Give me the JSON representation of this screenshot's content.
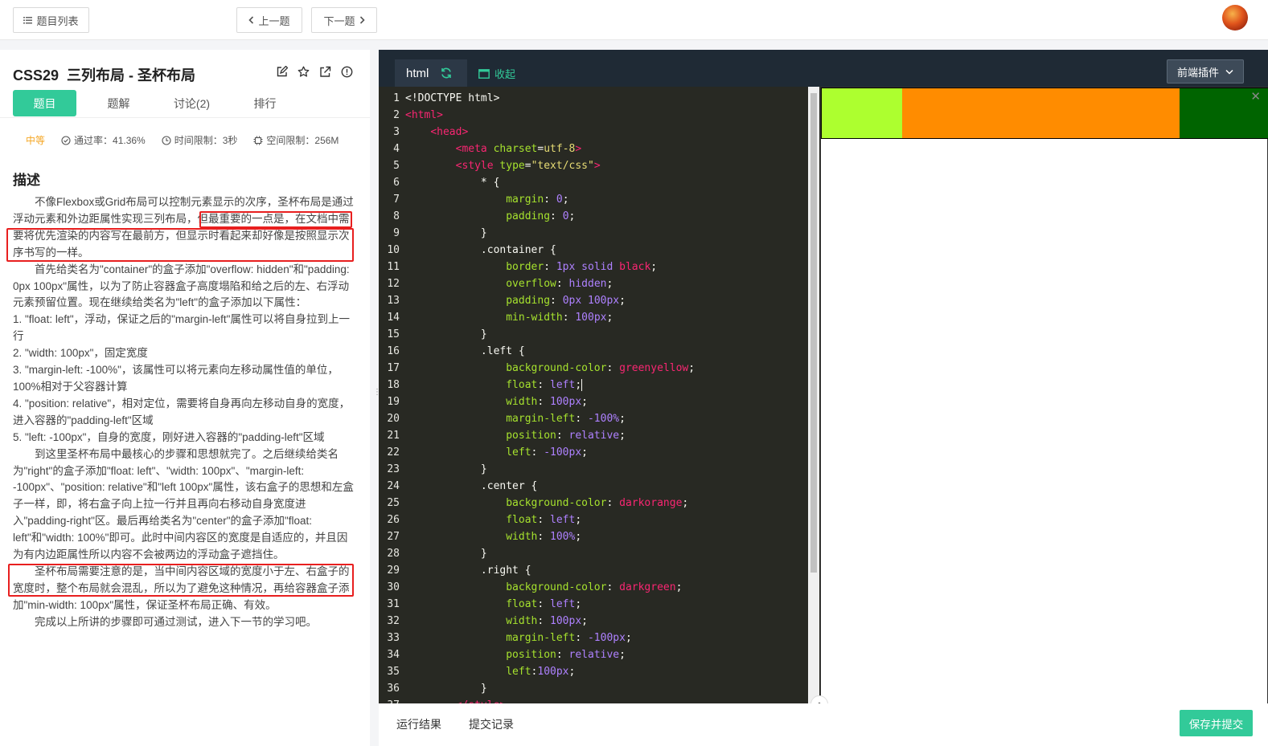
{
  "topbar": {
    "list_label": "题目列表",
    "prev_label": "上一题",
    "next_label": "下一题"
  },
  "problem": {
    "title": "CSS29  三列布局 - 圣杯布局",
    "tabs": [
      {
        "label": "题目"
      },
      {
        "label": "题解"
      },
      {
        "label": "讨论(2)"
      },
      {
        "label": "排行"
      }
    ],
    "difficulty": "中等",
    "pass_rate": "通过率：41.36%",
    "time_limit": "时间限制：3秒",
    "space_limit": "空间限制：256M",
    "desc_heading": "描述",
    "paragraphs": [
      "　　不像Flexbox或Grid布局可以控制元素显示的次序，圣杯布局是通过浮动元素和外边距属性实现三列布局，但最重要的一点是，在文档中需要将优先渲染的内容写在最前方，但显示时看起来却好像是按照显示次序书写的一样。",
      "　　首先给类名为\"container\"的盒子添加\"overflow: hidden\"和\"padding: 0px 100px\"属性，以为了防止容器盒子高度塌陷和给之后的左、右浮动元素预留位置。现在继续给类名为\"left\"的盒子添加以下属性：",
      "1. \"float: left\"，浮动，保证之后的\"margin-left\"属性可以将自身拉到上一行",
      "2. \"width: 100px\"，固定宽度",
      "3. \"margin-left: -100%\"，该属性可以将元素向左移动属性值的单位，100%相对于父容器计算",
      "4. \"position: relative\"，相对定位，需要将自身再向左移动自身的宽度，进入容器的\"padding-left\"区域",
      "5. \"left: -100px\"，自身的宽度，刚好进入容器的\"padding-left\"区域",
      "　　到这里圣杯布局中最核心的步骤和思想就完了。之后继续给类名为\"right\"的盒子添加\"float: left\"、\"width: 100px\"、\"margin-left: -100px\"、\"position: relative\"和\"left 100px\"属性，该右盒子的思想和左盒子一样，即，将右盒子向上拉一行并且再向右移动自身宽度进入\"padding-right\"区。最后再给类名为\"center\"的盒子添加\"float: left\"和\"width: 100%\"即可。此时中间内容区的宽度是自适应的，并且因为有内边距属性所以内容不会被两边的浮动盒子遮挡住。",
      "　　圣杯布局需要注意的是，当中间内容区域的宽度小于左、右盒子的宽度时，整个布局就会混乱，所以为了避免这种情况，再给容器盒子添加\"min-width: 100px\"属性，保证圣杯布局正确、有效。",
      "　　完成以上所讲的步骤即可通过测试，进入下一节的学习吧。"
    ]
  },
  "editor": {
    "tab_label": "html",
    "collapse_label": "收起",
    "plugin_label": "前端插件",
    "line_numbers": [
      "1",
      "2",
      "3",
      "4",
      "5",
      "6",
      "7",
      "8",
      "9",
      "10",
      "11",
      "12",
      "13",
      "14",
      "15",
      "16",
      "17",
      "18",
      "19",
      "20",
      "21",
      "22",
      "23",
      "24",
      "25",
      "26",
      "27",
      "28",
      "29",
      "30",
      "31",
      "32",
      "33",
      "34",
      "35",
      "36",
      "37"
    ]
  },
  "preview": {
    "colors": [
      "#adff2f",
      "#ff8c00",
      "#006400"
    ],
    "close_icon": "close-icon"
  },
  "bottom": {
    "result_label": "运行结果",
    "records_label": "提交记录",
    "submit_label": "保存并提交"
  },
  "colors": {
    "accent": "#32ca99",
    "highlight_border": "#e81f1f"
  }
}
